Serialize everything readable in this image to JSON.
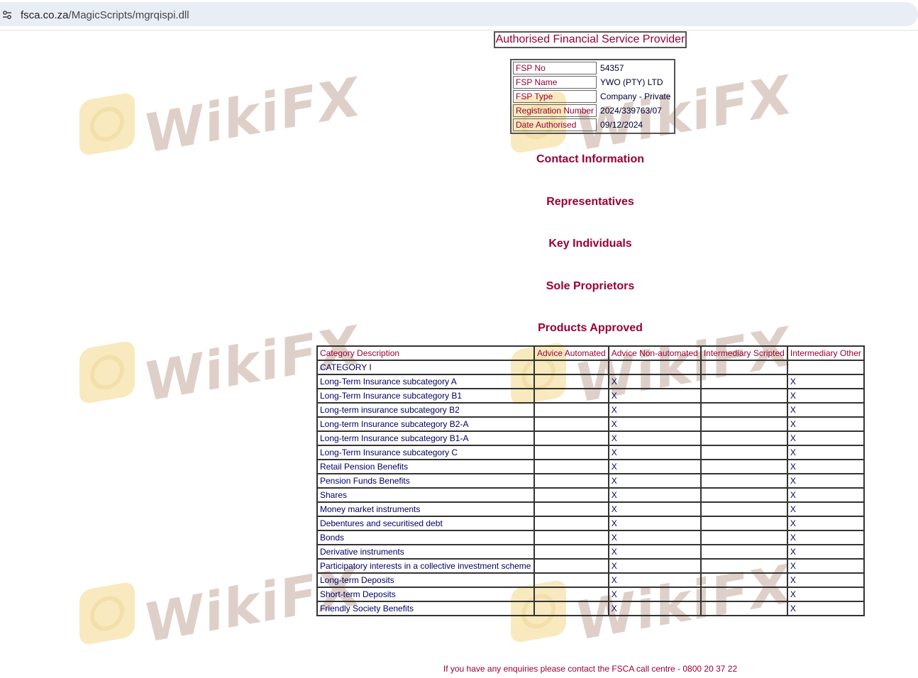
{
  "browser": {
    "url_host": "fsca.co.za",
    "url_path": "/MagicScripts/mgrqispi.dll",
    "site_icon": "tune-icon"
  },
  "watermark": {
    "text": "WikiFX"
  },
  "page": {
    "title": "Authorised Financial Service Provider",
    "info": [
      {
        "label": "FSP No",
        "value": "54357"
      },
      {
        "label": "FSP Name",
        "value": "YWO (PTY) LTD"
      },
      {
        "label": "FSP Type",
        "value": "Company - Private"
      },
      {
        "label": "Registration Number",
        "value": "2024/339763/07"
      },
      {
        "label": "Date Authorised",
        "value": "09/12/2024"
      }
    ],
    "sections": {
      "contact": "Contact Information",
      "representatives": "Representatives",
      "key_individuals": "Key Individuals",
      "sole_proprietors": "Sole Proprietors",
      "products": "Products Approved"
    },
    "products_table": {
      "headers": [
        "Category Description",
        "Advice Automated",
        "Advice Non-automated",
        "Intermediary Scripted",
        "Intermediary Other"
      ],
      "rows": [
        [
          "CATEGORY I",
          "",
          "",
          "",
          ""
        ],
        [
          "Long-Term Insurance subcategory A",
          "",
          "X",
          "",
          "X"
        ],
        [
          "Long-Term Insurance subcategory B1",
          "",
          "X",
          "",
          "X"
        ],
        [
          "Long-term insurance subcategory B2",
          "",
          "X",
          "",
          "X"
        ],
        [
          "Long-term Insurance subcategory B2-A",
          "",
          "X",
          "",
          "X"
        ],
        [
          "Long-term Insurance subcategory B1-A",
          "",
          "X",
          "",
          "X"
        ],
        [
          "Long-Term Insurance subcategory C",
          "",
          "X",
          "",
          "X"
        ],
        [
          "Retail Pension Benefits",
          "",
          "X",
          "",
          "X"
        ],
        [
          "Pension Funds Benefits",
          "",
          "X",
          "",
          "X"
        ],
        [
          "Shares",
          "",
          "X",
          "",
          "X"
        ],
        [
          "Money market instruments",
          "",
          "X",
          "",
          "X"
        ],
        [
          "Debentures and securitised debt",
          "",
          "X",
          "",
          "X"
        ],
        [
          "Bonds",
          "",
          "X",
          "",
          "X"
        ],
        [
          "Derivative instruments",
          "",
          "X",
          "",
          "X"
        ],
        [
          "Participatory interests in a collective investment scheme",
          "",
          "X",
          "",
          "X"
        ],
        [
          "Long-term Deposits",
          "",
          "X",
          "",
          "X"
        ],
        [
          "Short-term Deposits",
          "",
          "X",
          "",
          "X"
        ],
        [
          "Friendly Society Benefits",
          "",
          "X",
          "",
          "X"
        ]
      ]
    },
    "footer": "If you have any enquiries please contact the FSCA call centre - 0800 20 37 22"
  }
}
